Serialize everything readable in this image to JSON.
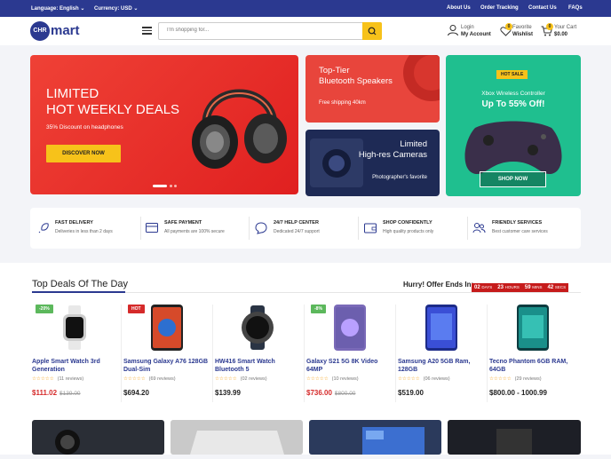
{
  "topbar": {
    "language": "Language: English",
    "currency": "Currency: USD",
    "about": "About Us",
    "tracking": "Order Tracking",
    "contact": "Contact Us",
    "faqs": "FAQs"
  },
  "header": {
    "logo_badge": "CHR",
    "logo_text": "mart",
    "search_placeholder": "I'm shopping for...",
    "login": "Login",
    "account": "My Account",
    "favorite": "Favorite",
    "wishlist": "Wishlist",
    "wishlist_count": "0",
    "cart_label": "Your Cart",
    "cart_total": "$0.00",
    "cart_count": "0"
  },
  "banners": {
    "main": {
      "line1": "LIMITED",
      "line2": "HOT WEEKLY DEALS",
      "sub": "35% Discount on headphones",
      "cta": "DISCOVER NOW"
    },
    "speakers": {
      "title1": "Top-Tier",
      "title2": "Bluetooth Speakers",
      "sub": "Free shipping 40km"
    },
    "cameras": {
      "title1": "Limited",
      "title2": "High-res Cameras",
      "sub": "Photographer's favorite"
    },
    "controller": {
      "badge": "HOT SALE",
      "title": "Xbox Wireless Controller",
      "offer": "Up To 55% Off!",
      "cta": "SHOP NOW"
    }
  },
  "services": [
    {
      "title": "Fast Delivery",
      "desc": "Deliveries in less than 2 days"
    },
    {
      "title": "Safe Payment",
      "desc": "All payments are 100% secure"
    },
    {
      "title": "24/7 Help Center",
      "desc": "Dedicated 24/7 support"
    },
    {
      "title": "Shop Confidently",
      "desc": "High quality products only"
    },
    {
      "title": "Friendly Services",
      "desc": "Best customer care services"
    }
  ],
  "deals": {
    "title": "Top Deals Of The Day",
    "offer_label": "Hurry! Offer Ends In:",
    "timer": {
      "days": "02",
      "days_label": "DAYS",
      "hours": "23",
      "hours_label": "HOURS",
      "mins": "59",
      "mins_label": "MINS",
      "secs": "42",
      "secs_label": "SECS"
    },
    "products": [
      {
        "badge": "-20%",
        "name": "Apple Smart Watch 3rd Generation",
        "reviews": "(11 reviews)",
        "price": "$111.02",
        "old": "$139.00"
      },
      {
        "badge": "HOT",
        "name": "Samsung Galaxy A76 128GB Dual-Sim",
        "reviews": "(69 reviews)",
        "price": "$694.20",
        "old": ""
      },
      {
        "badge": "",
        "name": "HW416 Smart Watch Bluetooth 5",
        "reviews": "(02 reviews)",
        "price": "$139.99",
        "old": ""
      },
      {
        "badge": "-8%",
        "name": "Galaxy S21 5G 8K Video 64MP",
        "reviews": "(10 reviews)",
        "price": "$736.00",
        "old": "$800.00"
      },
      {
        "badge": "",
        "name": "Samsung A20 5GB Ram, 128GB",
        "reviews": "(06 reviews)",
        "price": "$519.00",
        "old": ""
      },
      {
        "badge": "",
        "name": "Tecno Phantom 6GB RAM, 64GB",
        "reviews": "(29 reviews)",
        "price": "$800.00 - 1000.99",
        "old": ""
      }
    ]
  },
  "colors": {
    "navy": "#2b3990",
    "red": "#e8453c",
    "green": "#1fbf8f",
    "yellow": "#f7c21a"
  }
}
